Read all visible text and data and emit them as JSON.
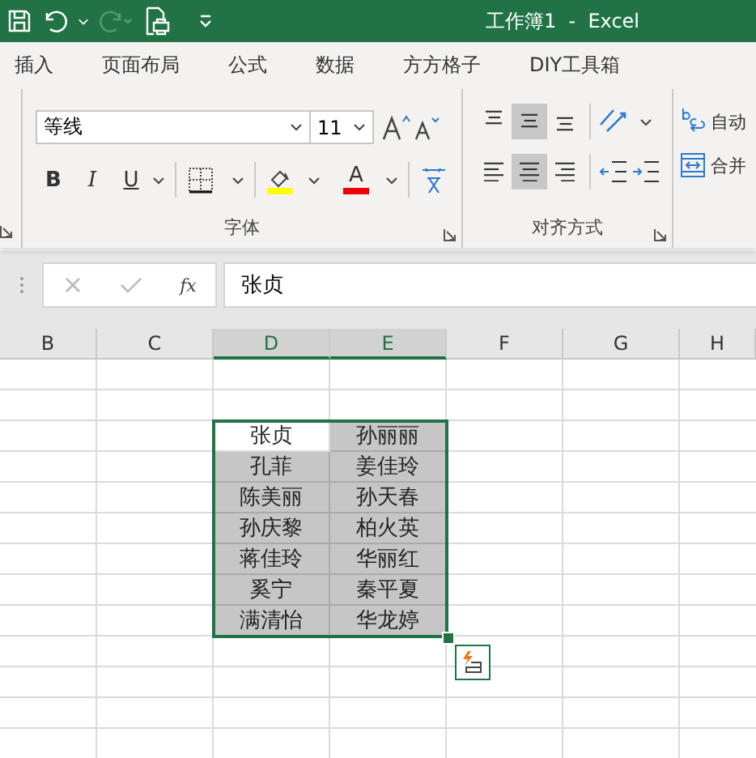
{
  "title_bar": {
    "title": "工作簿1  -  Excel"
  },
  "tabs": [
    "插入",
    "页面布局",
    "公式",
    "数据",
    "方方格子",
    "DIY工具箱"
  ],
  "font_group": {
    "font_name": "等线",
    "font_size": "11",
    "style_buttons": [
      "B",
      "I",
      "U"
    ],
    "font_color_glyph": "A",
    "label": "字体"
  },
  "alignment_group": {
    "label": "对齐方式",
    "buttons": [
      {
        "kind": "top",
        "selected": false
      },
      {
        "kind": "middle",
        "selected": true
      },
      {
        "kind": "bottom",
        "selected": false
      },
      {
        "kind": "left",
        "selected": false
      },
      {
        "kind": "center",
        "selected": true
      },
      {
        "kind": "right",
        "selected": false
      }
    ],
    "wrap_text": "自动",
    "merge": "合并"
  },
  "formula_bar": {
    "function_label": "fx",
    "value": "张贞"
  },
  "sheet": {
    "columns": [
      {
        "label": "B",
        "selected": false
      },
      {
        "label": "C",
        "selected": false
      },
      {
        "label": "D",
        "selected": true
      },
      {
        "label": "E",
        "selected": true
      },
      {
        "label": "F",
        "selected": false
      },
      {
        "label": "G",
        "selected": false
      },
      {
        "label": "H",
        "selected": false
      }
    ],
    "rows": [
      [
        "张贞",
        "孙丽丽"
      ],
      [
        "孔菲",
        "姜佳玲"
      ],
      [
        "陈美丽",
        "孙天春"
      ],
      [
        "孙庆黎",
        "柏火英"
      ],
      [
        "蒋佳玲",
        "华丽红"
      ],
      [
        "奚宁",
        "秦平夏"
      ],
      [
        "满清怡",
        "华龙婷"
      ]
    ]
  }
}
